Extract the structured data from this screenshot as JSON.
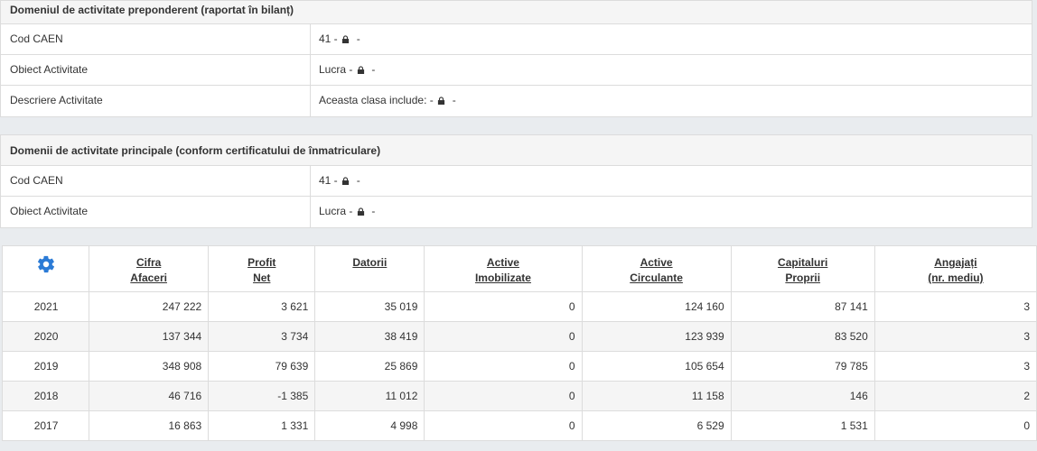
{
  "preponderent": {
    "title": "Domeniul de activitate preponderent (raportat în bilanț)",
    "rows": [
      {
        "label": "Cod CAEN",
        "value": "41 -",
        "suffix": "-"
      },
      {
        "label": "Obiect Activitate",
        "value": "Lucra -",
        "suffix": "-"
      },
      {
        "label": "Descriere Activitate",
        "value": "Aceasta clasa include: -",
        "suffix": "-"
      }
    ]
  },
  "principale": {
    "title": "Domenii de activitate principale (conform certificatului de înmatriculare)",
    "rows": [
      {
        "label": "Cod CAEN",
        "value": "41 -",
        "suffix": "-"
      },
      {
        "label": "Obiect Activitate",
        "value": "Lucra -",
        "suffix": "-"
      }
    ]
  },
  "financial": {
    "settings_icon": "gear-icon",
    "accent": "#2b7bd6",
    "headers": [
      [
        "Cifra",
        "Afaceri"
      ],
      [
        "Profit",
        "Net"
      ],
      [
        "Datorii",
        ""
      ],
      [
        "Active",
        "Imobilizate"
      ],
      [
        "Active",
        "Circulante"
      ],
      [
        "Capitaluri",
        "Proprii"
      ],
      [
        "Angajați",
        "(nr. mediu)"
      ]
    ],
    "rows": [
      {
        "year": "2021",
        "cells": [
          "247 222",
          "3 621",
          "35 019",
          "0",
          "124 160",
          "87 141",
          "3"
        ]
      },
      {
        "year": "2020",
        "cells": [
          "137 344",
          "3 734",
          "38 419",
          "0",
          "123 939",
          "83 520",
          "3"
        ]
      },
      {
        "year": "2019",
        "cells": [
          "348 908",
          "79 639",
          "25 869",
          "0",
          "105 654",
          "79 785",
          "3"
        ]
      },
      {
        "year": "2018",
        "cells": [
          "46 716",
          "-1 385",
          "11 012",
          "0",
          "11 158",
          "146",
          "2"
        ]
      },
      {
        "year": "2017",
        "cells": [
          "16 863",
          "1 331",
          "4 998",
          "0",
          "6 529",
          "1 531",
          "0"
        ]
      }
    ]
  }
}
